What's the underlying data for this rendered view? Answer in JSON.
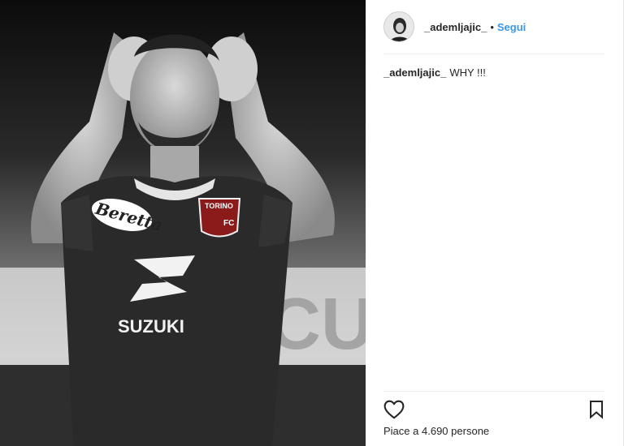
{
  "post": {
    "username": "_ademljajic_",
    "separator": "•",
    "follow_label": "Segui",
    "caption_user": "_ademljajic_",
    "caption_text": "WHY !!!",
    "likes_prefix": "Piace a",
    "likes_count": "4.690",
    "likes_suffix": "persone"
  },
  "image": {
    "jersey_sponsor": "SUZUKI",
    "sleeve_sponsor": "Beretta",
    "crest_text": "TORINO",
    "crest_letters": "FC",
    "background_text": "CU"
  },
  "icons": {
    "like": "heart-icon",
    "save": "bookmark-icon"
  },
  "colors": {
    "follow": "#3897f0",
    "crest": "#8b1a1a",
    "text": "#262626"
  }
}
